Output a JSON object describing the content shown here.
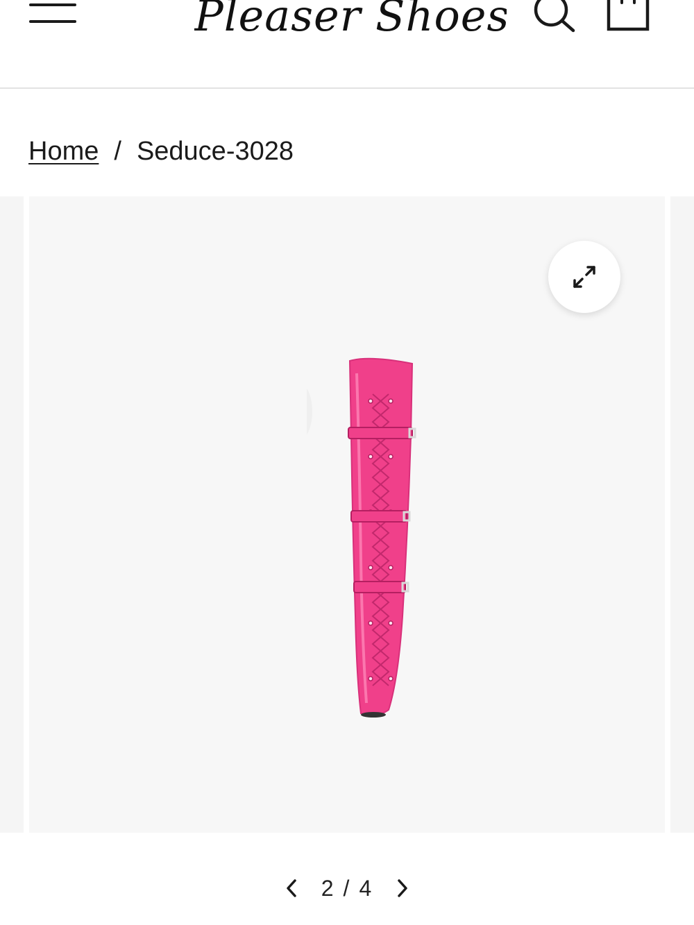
{
  "header": {
    "logo_text": "Pleaser Shoes",
    "menu_icon": "hamburger-menu-icon",
    "search_icon": "search-icon",
    "cart_icon": "shopping-bag-icon"
  },
  "breadcrumb": {
    "home_label": "Home",
    "separator": "/",
    "current_label": "Seduce-3028"
  },
  "gallery": {
    "zoom_icon": "expand-icon",
    "product_color": "#f0408a"
  },
  "pager": {
    "current": "2",
    "separator": "/",
    "total": "4",
    "prev_icon": "chevron-left-icon",
    "next_icon": "chevron-right-icon"
  }
}
